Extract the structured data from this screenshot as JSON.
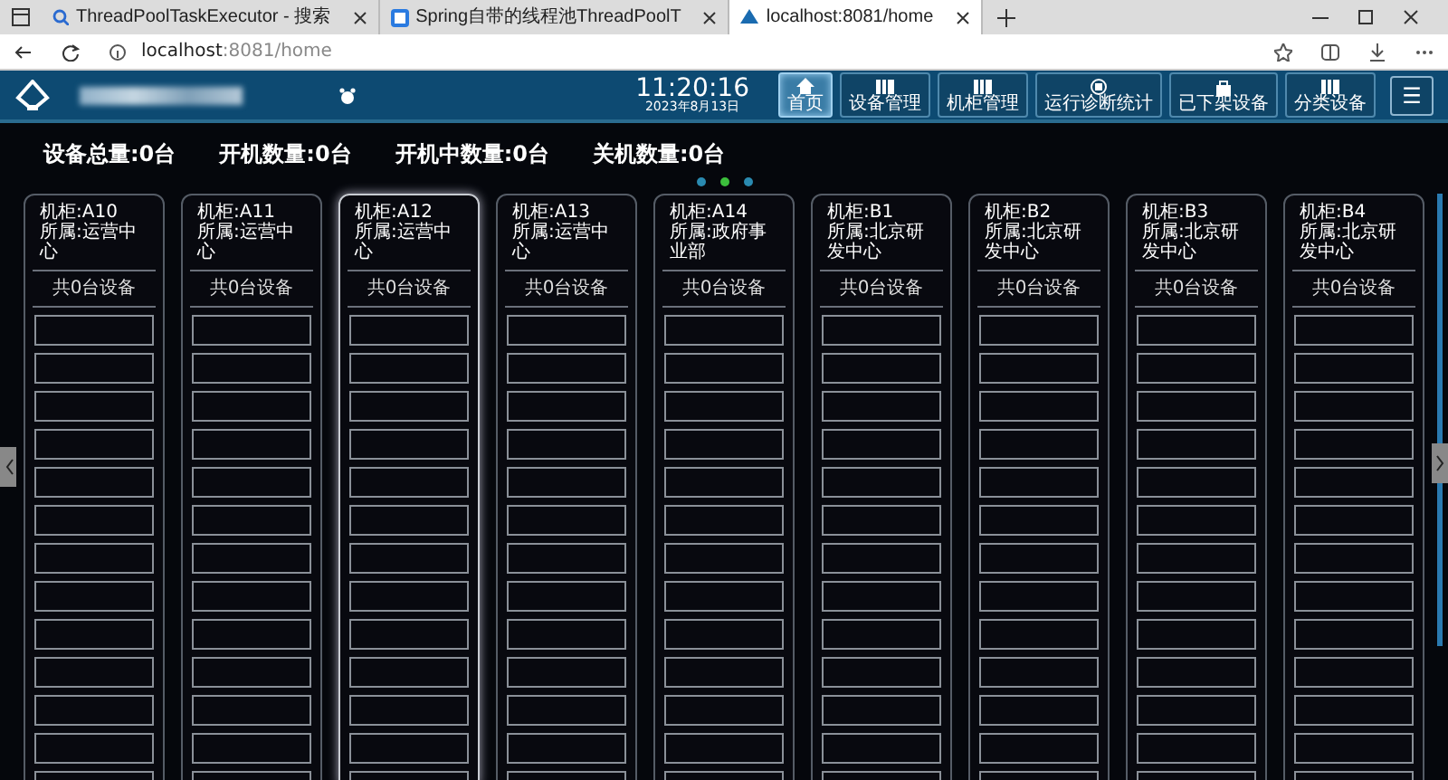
{
  "browser": {
    "tabs": [
      {
        "kind": "search",
        "title": "ThreadPoolTaskExecutor - 搜索",
        "selected": false
      },
      {
        "kind": "page",
        "title": "Spring自带的线程池ThreadPoolT",
        "selected": false
      },
      {
        "kind": "site",
        "title": "localhost:8081/home",
        "selected": true
      }
    ],
    "address": {
      "host": "localhost",
      "path": ":8081/home"
    }
  },
  "header": {
    "time": "11:20:16",
    "date": "2023年8月13日",
    "nav": [
      {
        "kind": "home",
        "label": "首页",
        "selected": true
      },
      {
        "kind": "rack",
        "label": "设备管理",
        "selected": false
      },
      {
        "kind": "rack",
        "label": "机柜管理",
        "selected": false
      },
      {
        "kind": "circle",
        "label": "运行诊断统计",
        "selected": false
      },
      {
        "kind": "lock",
        "label": "已下架设备",
        "selected": false
      },
      {
        "kind": "rack",
        "label": "分类设备",
        "selected": false
      }
    ],
    "menu_button": "☰"
  },
  "stats": [
    "设备总量:0台",
    "开机数量:0台",
    "开机中数量:0台",
    "关机数量:0台"
  ],
  "carousel_dots": [
    {
      "selected": false
    },
    {
      "selected": true
    },
    {
      "selected": false
    }
  ],
  "racks": [
    {
      "name": "机柜:A10",
      "owner": "所属:运营中心",
      "count": "共0台设备",
      "selected": false
    },
    {
      "name": "机柜:A11",
      "owner": "所属:运营中心",
      "count": "共0台设备",
      "selected": false
    },
    {
      "name": "机柜:A12",
      "owner": "所属:运营中心",
      "count": "共0台设备",
      "selected": true
    },
    {
      "name": "机柜:A13",
      "owner": "所属:运营中心",
      "count": "共0台设备",
      "selected": false
    },
    {
      "name": "机柜:A14",
      "owner": "所属:政府事业部",
      "count": "共0台设备",
      "selected": false
    },
    {
      "name": "机柜:B1",
      "owner": "所属:北京研发中心",
      "count": "共0台设备",
      "selected": false
    },
    {
      "name": "机柜:B2",
      "owner": "所属:北京研发中心",
      "count": "共0台设备",
      "selected": false
    },
    {
      "name": "机柜:B3",
      "owner": "所属:北京研发中心",
      "count": "共0台设备",
      "selected": false
    },
    {
      "name": "机柜:B4",
      "owner": "所属:北京研发中心",
      "count": "共0台设备",
      "selected": false
    }
  ]
}
